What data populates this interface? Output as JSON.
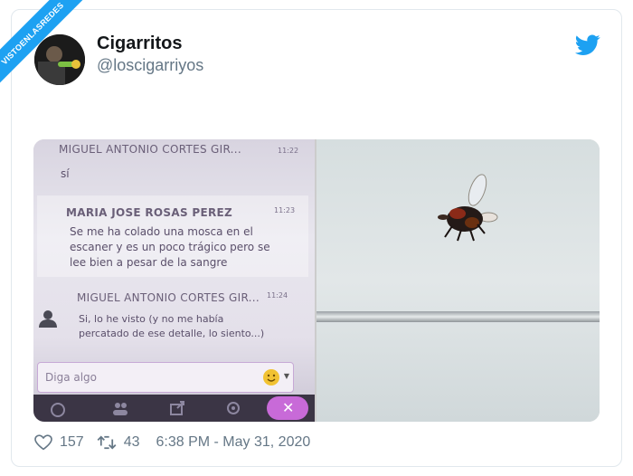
{
  "watermark": "VISTOENLASREDES",
  "tweet": {
    "display_name": "Cigarritos",
    "handle": "@loscigarriyos",
    "likes": "157",
    "retweets": "43",
    "timestamp": "6:38 PM - May 31, 2020"
  },
  "chat": {
    "msg1": {
      "sender": "MIGUEL ANTONIO CORTES GIR...",
      "time": "11:22",
      "text": "sí"
    },
    "msg2": {
      "sender": "MARIA JOSE ROSAS PEREZ",
      "time": "11:23",
      "lines": [
        "Se me ha colado una mosca en el",
        "escaner y es un poco trágico pero se",
        "lee bien a pesar de la sangre"
      ]
    },
    "msg3": {
      "sender": "MIGUEL ANTONIO CORTES GIR...",
      "time": "11:24",
      "lines": [
        "Si, lo he visto (y no me había",
        "percatado de ese detalle, lo siento...)"
      ]
    },
    "input_placeholder": "Diga algo"
  },
  "icons": {
    "like": "heart-icon",
    "retweet": "retweet-icon",
    "twitter": "twitter-bird-icon"
  },
  "colors": {
    "twitter_blue": "#1da1f2",
    "chat_accent": "#c7a9d6"
  }
}
